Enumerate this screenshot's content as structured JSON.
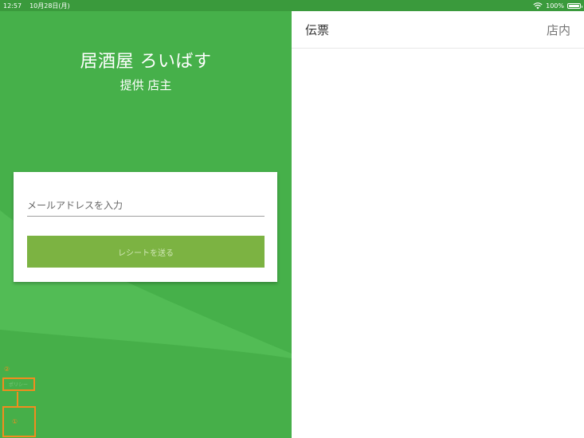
{
  "status_bar": {
    "time": "12:57",
    "date": "10月28日(月)",
    "battery": "100%",
    "wifi_icon": "wifi-icon",
    "battery_icon": "battery-icon"
  },
  "left_panel": {
    "restaurant_name": "居酒屋 ろいばす",
    "provider": "提供 店主",
    "email_placeholder": "メールアドレスを入力",
    "send_button_label": "レシートを送る",
    "accent_color": "#46b04a",
    "button_color": "#7cb342"
  },
  "annotations": {
    "marker_2": "②",
    "marker_1": "①",
    "small_link_text": "ポリシー",
    "color": "#f28c1e"
  },
  "right_panel": {
    "title": "伝票",
    "tab": "店内"
  }
}
